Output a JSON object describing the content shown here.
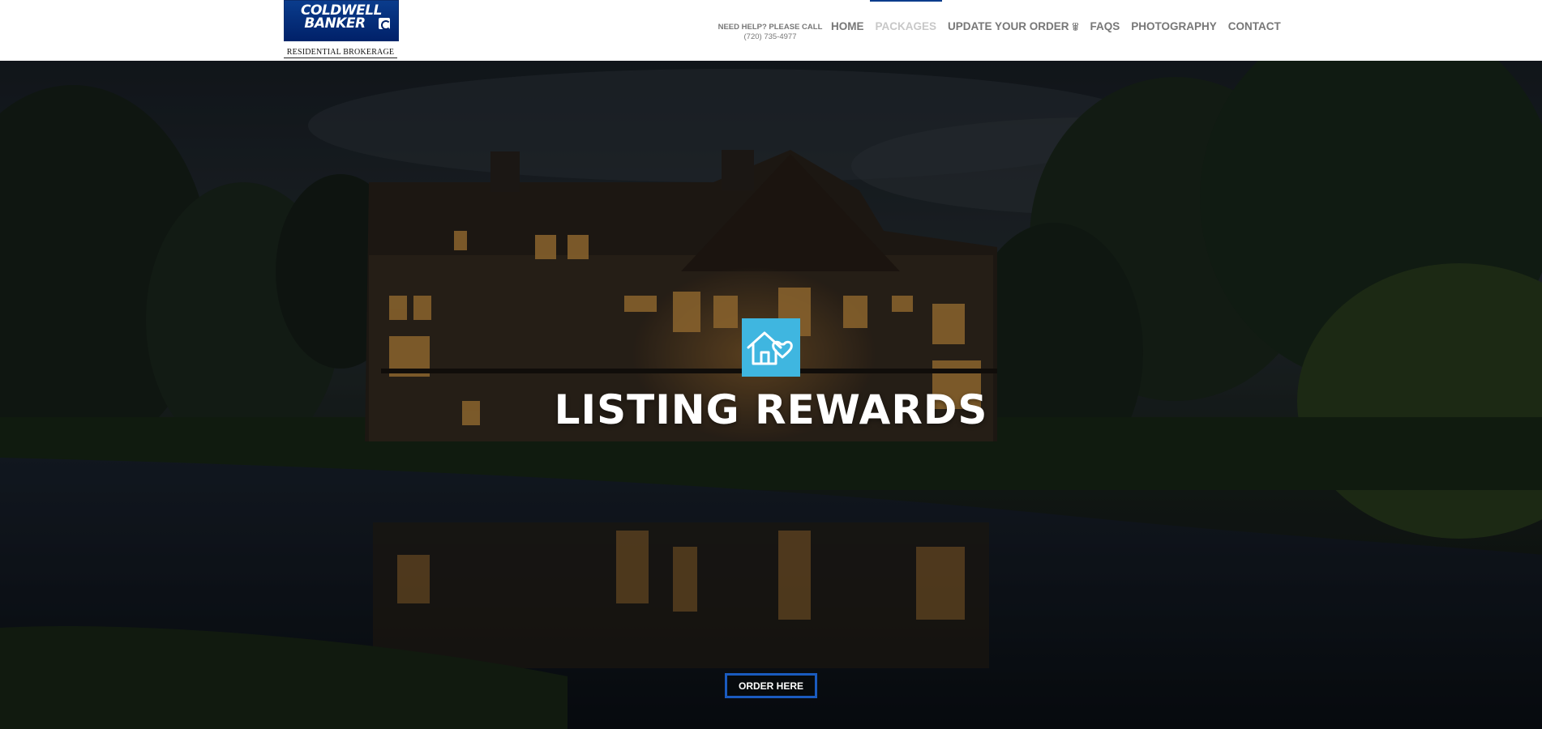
{
  "logo": {
    "line1": "COLDWELL",
    "line2": "BANKER",
    "sub": "RESIDENTIAL BROKERAGE"
  },
  "help": {
    "text": "NEED HELP? PLEASE CALL",
    "phone": "(720) 735-4977"
  },
  "nav": {
    "home": "HOME",
    "packages": "PACKAGES",
    "update": "UPDATE YOUR ORDER",
    "faqs": "FAQS",
    "photography": "PHOTOGRAPHY",
    "contact": "CONTACT"
  },
  "hero": {
    "title": "LISTING REWARDS",
    "button": "ORDER HERE"
  },
  "colors": {
    "brand_blue": "#012169",
    "badge_blue": "#3fb6e0",
    "button_border": "#1a5bbf"
  },
  "icons": [
    "house-heart-icon",
    "chevron-down-icon"
  ]
}
